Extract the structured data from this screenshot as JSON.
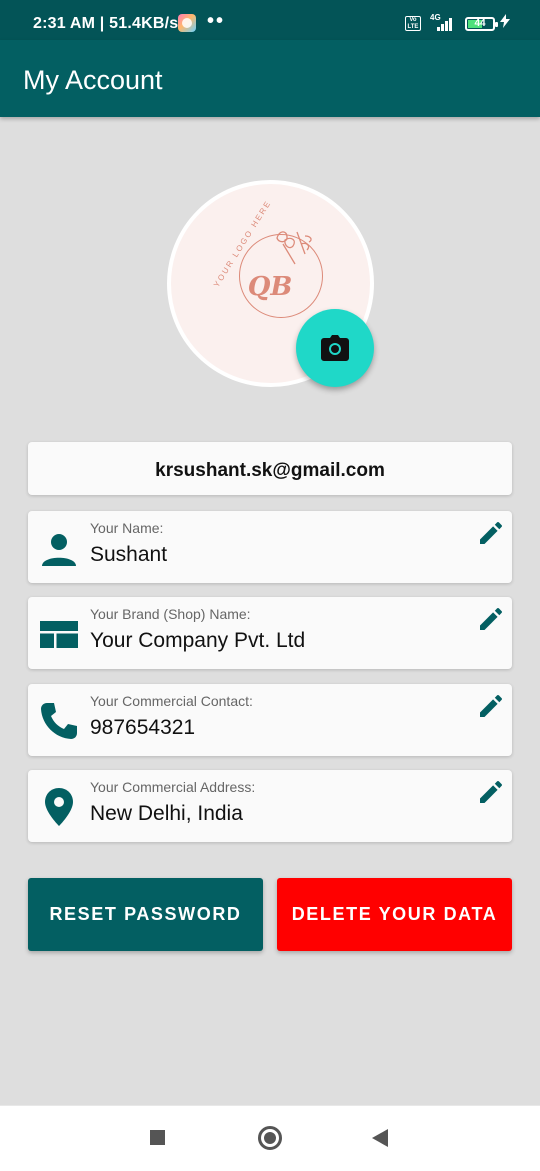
{
  "status_bar": {
    "time": "2:31 AM | 51.4KB/s",
    "dots": "••",
    "volte": "Vo LTE",
    "network": "4G",
    "battery": "44",
    "charging_icon": "lightning-icon"
  },
  "app_bar": {
    "title": "My Account"
  },
  "profile": {
    "logo_monogram": "QB",
    "logo_text": "YOUR LOGO HERE",
    "camera_icon": "camera-icon"
  },
  "email": "krsushant.sk@gmail.com",
  "fields": [
    {
      "label": "Your Name:",
      "value": "Sushant",
      "icon": "person-icon"
    },
    {
      "label": "Your Brand (Shop) Name:",
      "value": "Your Company Pvt. Ltd",
      "icon": "store-icon"
    },
    {
      "label": "Your Commercial Contact:",
      "value": "987654321",
      "icon": "phone-icon"
    },
    {
      "label": "Your Commercial Address:",
      "value": "New Delhi, India",
      "icon": "location-pin-icon"
    }
  ],
  "buttons": {
    "reset": "RESET PASSWORD",
    "delete": "DELETE YOUR DATA"
  },
  "colors": {
    "primary": "#035f62",
    "accent": "#1fd8c8",
    "danger": "#ff0000",
    "background": "#dedede"
  }
}
